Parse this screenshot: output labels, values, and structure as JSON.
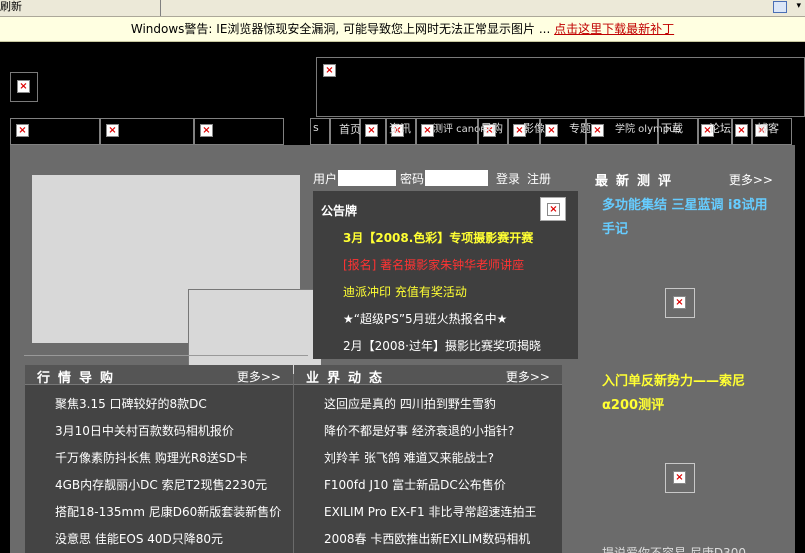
{
  "browser": {
    "toolbar_label": "刷新",
    "warning_text": "Windows警告: IE浏览器惊现安全漏洞, 可能导致您上网时无法正常显示图片 ... ",
    "warning_link": "点击这里下载最新补丁"
  },
  "nav": {
    "items": [
      {
        "label": ""
      },
      {
        "label": ""
      },
      {
        "label": ""
      },
      {
        "label": "s"
      },
      {
        "label": "首页"
      },
      {
        "label": ""
      },
      {
        "label": "资讯"
      },
      {
        "label": "测评 canon"
      },
      {
        "label": "导购"
      },
      {
        "label": "影像"
      },
      {
        "label": "专题"
      },
      {
        "label": "学院 olympus"
      },
      {
        "label": "下载"
      },
      {
        "label": "论坛"
      },
      {
        "label": ""
      },
      {
        "label": "博客"
      }
    ]
  },
  "login": {
    "user_label": "用户",
    "password_label": "密码",
    "login_button": "登录",
    "register_button": "注册"
  },
  "notice": {
    "title": "公告牌",
    "items": [
      {
        "text": "3月【2008.色彩】专项摄影赛开赛",
        "color": "#ffff33"
      },
      {
        "text": "[报名] 著名摄影家朱钟华老师讲座",
        "color": "#ff3333"
      },
      {
        "text": "迪派冲印 充值有奖活动",
        "color": "#ffff33"
      },
      {
        "text": "★“超级PS”5月班火热报名中★",
        "color": "#ffffff"
      },
      {
        "text": "2月【2008·过年】摄影比赛奖项揭晓",
        "color": "#ffffff"
      }
    ]
  },
  "buying_guide": {
    "title": "行情导购",
    "more": "更多>>",
    "items": [
      "聚焦3.15 口碑较好的8款DC",
      "3月10日中关村百款数码相机报价",
      "千万像素防抖长焦 购理光R8送SD卡",
      "4GB内存靓丽小DC 索尼T2现售2230元",
      "搭配18-135mm 尼康D60新版套装新售价",
      "没意思 佳能EOS 40D只降80元"
    ]
  },
  "industry_news": {
    "title": "业界动态",
    "more": "更多>>",
    "items": [
      "这回应是真的 四川拍到野生雪豹",
      "降价不都是好事 经济衰退的小指针?",
      "刘羚羊 张飞鸽 难道又来能战士?",
      "F100fd J10 富士新品DC公布售价",
      "EXILIM Pro EX-F1 非比寻常超速连拍王",
      "2008春 卡西欧推出新EXILIM数码相机"
    ]
  },
  "reviews": {
    "title": "最新测评",
    "more": "更多>>",
    "item1": "多功能集结 三星蓝调 i8试用手记",
    "item2": "入门单反新势力——索尼α200测评",
    "bottom": "提说爱你不容易  尼康D300",
    "colors": {
      "item1": "#66ccff",
      "item2": "#ffff33"
    }
  }
}
